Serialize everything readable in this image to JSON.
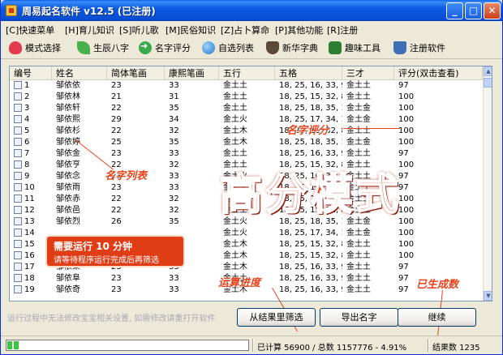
{
  "window": {
    "title": "周易起名软件 v12.5 (已注册)"
  },
  "menu": [
    {
      "label": "[C]快速菜单"
    },
    {
      "label": "[H]育儿知识"
    },
    {
      "label": "[S]听儿歌"
    },
    {
      "label": "[M]民俗知识"
    },
    {
      "label": "[Z]占卜算命"
    },
    {
      "label": "[P]其他功能"
    },
    {
      "label": "[R]注册"
    }
  ],
  "toolbar": [
    {
      "label": "模式选择",
      "icon": "heart-icon"
    },
    {
      "label": "生辰八字",
      "icon": "leaf-icon"
    },
    {
      "label": "名字评分",
      "icon": "arrow-right-icon"
    },
    {
      "label": "自选列表",
      "icon": "globe-icon"
    },
    {
      "label": "新华字典",
      "icon": "scholar-icon"
    },
    {
      "label": "趣味工具",
      "icon": "game-icon"
    },
    {
      "label": "注册软件",
      "icon": "cup-icon"
    }
  ],
  "table": {
    "headers": [
      "编号",
      "姓名",
      "简体笔画",
      "康熙笔画",
      "五行",
      "五格",
      "三才",
      "评分(双击查看)"
    ],
    "rows": [
      [
        "1",
        "邹依依",
        "23",
        "33",
        "金土土",
        "18, 25, 16, 33, 9",
        "金土土",
        "97"
      ],
      [
        "2",
        "邹依林",
        "21",
        "31",
        "金土土",
        "18, 25, 15, 32, 8",
        "金土土",
        "100"
      ],
      [
        "3",
        "邹依轩",
        "22",
        "35",
        "金土土",
        "18, 25, 18, 35, 11",
        "金土金",
        "100"
      ],
      [
        "4",
        "邹依熙",
        "29",
        "34",
        "金土火",
        "18, 25, 17, 34, 10",
        "金土金",
        "100"
      ],
      [
        "5",
        "邹依杉",
        "22",
        "32",
        "金土木",
        "18, 25, 15, 32, 8",
        "金土土",
        "100"
      ],
      [
        "6",
        "邹依婷",
        "25",
        "35",
        "金土木",
        "18, 25, 18, 35, 11",
        "金土金",
        "100"
      ],
      [
        "7",
        "邹依金",
        "23",
        "33",
        "金土土",
        "18, 25, 16, 33, 9",
        "金土土",
        "97"
      ],
      [
        "8",
        "邹依亨",
        "22",
        "32",
        "金土土",
        "18, 25, 15, 32, 8",
        "金土土",
        "100"
      ],
      [
        "9",
        "邹依念",
        "23",
        "33",
        "金土火",
        "18, 25, 16, 33, 9",
        "金土土",
        "97"
      ],
      [
        "10",
        "邹依雨",
        "23",
        "33",
        "金土土",
        "18, 25, 16, 33, 9",
        "金土土",
        "97"
      ],
      [
        "11",
        "邹依赤",
        "22",
        "32",
        "金土火",
        "18, 25, 15, 32, 8",
        "金土土",
        "100"
      ],
      [
        "12",
        "邹依邑",
        "22",
        "32",
        "金土土",
        "18, 25, 15, 32, 8",
        "金土土",
        "100"
      ],
      [
        "13",
        "邹依烈",
        "26",
        "35",
        "金土火",
        "18, 25, 18, 35, 11",
        "金土金",
        "100"
      ],
      [
        "14",
        "",
        "",
        "",
        "金土火",
        "18, 25, 17, 34, 10",
        "金土金",
        "100"
      ],
      [
        "15",
        "",
        "",
        "",
        "金土木",
        "18, 25, 15, 32, 8",
        "金土土",
        "100"
      ],
      [
        "16",
        "",
        "",
        "",
        "金土木",
        "18, 25, 15, 32, 8",
        "金土土",
        "100"
      ],
      [
        "17",
        "邹依果",
        "23",
        "33",
        "金土木",
        "18, 25, 16, 33, 9",
        "金土土",
        "97"
      ],
      [
        "18",
        "邹依阜",
        "23",
        "33",
        "金土土",
        "18, 25, 16, 33, 9",
        "金土土",
        "97"
      ],
      [
        "19",
        "邹依奇",
        "23",
        "33",
        "金土木",
        "18, 25, 16, 33, 9",
        "金土土",
        "97"
      ]
    ]
  },
  "annotations": {
    "big": "高分模式",
    "name_score": "名字评分",
    "name_list": "名字列表",
    "progress": "运算进度",
    "generated": "已生成数"
  },
  "notice": {
    "line1": "需要运行 10 分钟",
    "line2": "请等待程序运行完成后再筛选"
  },
  "hint": "运行过程中无法修改宝宝相关设置, 如需修改请重打开软件",
  "buttons": {
    "filter": "从结果里筛选",
    "export": "导出名字",
    "continue": "继续"
  },
  "status": {
    "computed": "已计算 56900 / 总数 1157776 - 4.91%",
    "results": "结果数 1235",
    "progress_fraction": 0.0491
  }
}
